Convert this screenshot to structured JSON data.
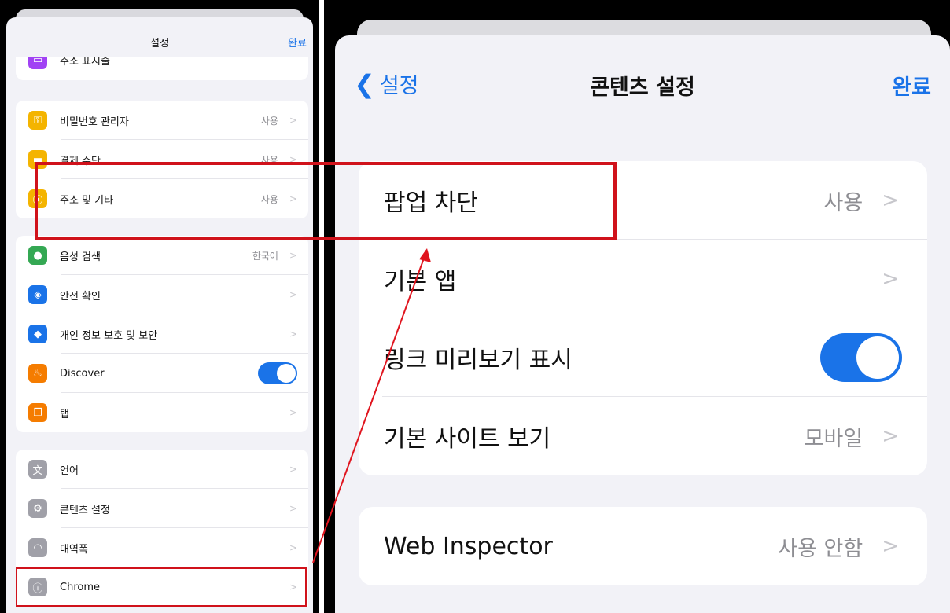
{
  "left": {
    "title": "설정",
    "done": "완료",
    "cut_row": {
      "label": "주소 표시줄",
      "value": ""
    },
    "group1": [
      {
        "label": "비밀번호 관리자",
        "value": "사용",
        "icon": "key-icon",
        "color": "#f4b400"
      },
      {
        "label": "결제 수단",
        "value": "사용",
        "icon": "card-icon",
        "color": "#f4b400"
      },
      {
        "label": "주소 및 기타",
        "value": "사용",
        "icon": "location-icon",
        "color": "#f4b400"
      }
    ],
    "group2": [
      {
        "label": "음성 검색",
        "value": "한국어",
        "icon": "mic-icon",
        "color": "#34a853"
      },
      {
        "label": "안전 확인",
        "value": "",
        "icon": "shield-icon",
        "color": "#1a73e8"
      },
      {
        "label": "개인 정보 보호 및 보안",
        "value": "",
        "icon": "privacy-icon",
        "color": "#1a73e8"
      },
      {
        "label": "Discover",
        "value": "",
        "icon": "flame-icon",
        "color": "#f57c00",
        "toggle": true
      },
      {
        "label": "탭",
        "value": "",
        "icon": "tabs-icon",
        "color": "#f57c00"
      }
    ],
    "group3": [
      {
        "label": "언어",
        "value": "",
        "icon": "translate-icon",
        "color": "#a0a0a8"
      },
      {
        "label": "콘텐츠 설정",
        "value": "",
        "icon": "gear-icon",
        "color": "#a0a0a8"
      },
      {
        "label": "대역폭",
        "value": "",
        "icon": "wifi-icon",
        "color": "#a0a0a8"
      },
      {
        "label": "Chrome",
        "value": "",
        "icon": "info-icon",
        "color": "#a0a0a8"
      }
    ]
  },
  "right": {
    "back": "설정",
    "title": "콘텐츠 설정",
    "done": "완료",
    "group1": [
      {
        "label": "팝업 차단",
        "value": "사용"
      },
      {
        "label": "기본 앱",
        "value": ""
      },
      {
        "label": "링크 미리보기 표시",
        "value": "",
        "toggle": true
      },
      {
        "label": "기본 사이트 보기",
        "value": "모바일"
      }
    ],
    "group2": [
      {
        "label": "Web Inspector",
        "value": "사용 안함"
      }
    ]
  },
  "colors": {
    "accent": "#1a73e8",
    "highlight": "#d0121b"
  }
}
